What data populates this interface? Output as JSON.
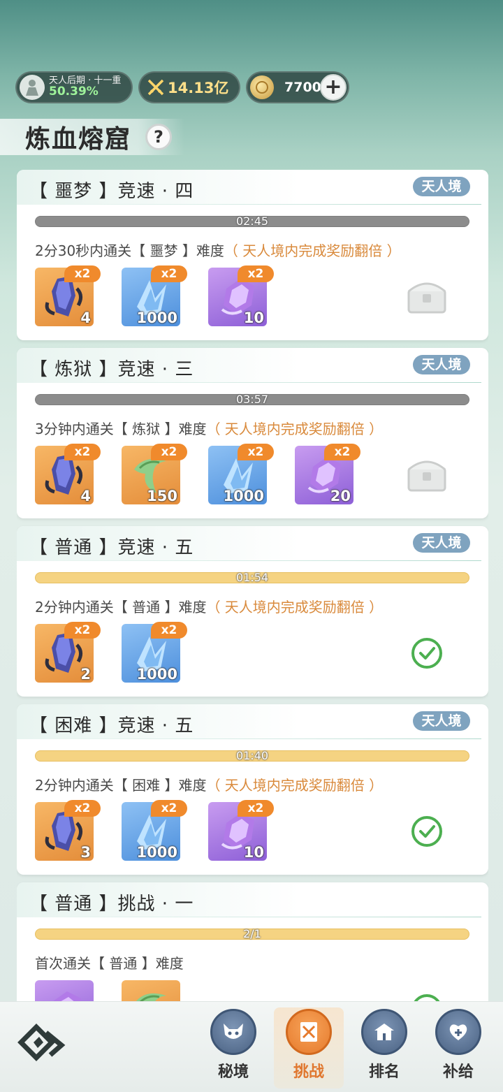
{
  "status": {
    "realm_name": "天人后期 · 十一重",
    "realm_progress": "50.39%",
    "power": "14.13亿",
    "coins": "7700"
  },
  "title": "炼血熔窟",
  "cards": [
    {
      "title": "【 噩梦 】竞速 · 四",
      "badge": "天人境",
      "timer": "02:45",
      "desc_main": "2分30秒内通关【 噩梦 】难度",
      "desc_note": "（ 天人境内完成奖励翻倍 ）",
      "rewards": [
        {
          "icon": "dark-crystal-icon",
          "multiplier": "x2",
          "qty": "4"
        },
        {
          "icon": "blue-crystal-icon",
          "multiplier": "x2",
          "qty": "1000"
        },
        {
          "icon": "purple-gem-icon",
          "multiplier": "x2",
          "qty": "10"
        }
      ],
      "status_icon": "treasure-chest-icon"
    },
    {
      "title": "【 炼狱 】竞速 · 三",
      "badge": "天人境",
      "timer": "03:57",
      "desc_main": "3分钟内通关【 炼狱 】难度",
      "desc_note": "（ 天人境内完成奖励翻倍 ）",
      "rewards": [
        {
          "icon": "dark-crystal-icon",
          "multiplier": "x2",
          "qty": "4"
        },
        {
          "icon": "green-fang-icon",
          "multiplier": "x2",
          "qty": "150"
        },
        {
          "icon": "blue-crystal-icon",
          "multiplier": "x2",
          "qty": "1000"
        },
        {
          "icon": "purple-gem-icon",
          "multiplier": "x2",
          "qty": "20"
        }
      ],
      "status_icon": "treasure-chest-icon"
    },
    {
      "title": "【 普通 】竞速 · 五",
      "badge": "天人境",
      "timer": "01:54",
      "desc_main": "2分钟内通关【 普通 】难度",
      "desc_note": "（ 天人境内完成奖励翻倍 ）",
      "rewards": [
        {
          "icon": "dark-crystal-icon",
          "multiplier": "x2",
          "qty": "2"
        },
        {
          "icon": "blue-crystal-icon",
          "multiplier": "x2",
          "qty": "1000"
        }
      ],
      "status_icon": "check-icon"
    },
    {
      "title": "【 困难 】竞速 · 五",
      "badge": "天人境",
      "timer": "01:40",
      "desc_main": "2分钟内通关【 困难 】难度",
      "desc_note": "（ 天人境内完成奖励翻倍 ）",
      "rewards": [
        {
          "icon": "dark-crystal-icon",
          "multiplier": "x2",
          "qty": "3"
        },
        {
          "icon": "blue-crystal-icon",
          "multiplier": "x2",
          "qty": "1000"
        },
        {
          "icon": "purple-gem-icon",
          "multiplier": "x2",
          "qty": "10"
        }
      ],
      "status_icon": "check-icon"
    },
    {
      "title": "【 普通 】挑战 · 一",
      "badge": "",
      "timer": "2/1",
      "desc_main": "首次通关【 普通 】难度",
      "desc_note": "",
      "rewards": [
        {
          "icon": "purple-gem-icon",
          "multiplier": "",
          "qty": ""
        },
        {
          "icon": "green-fang-icon",
          "multiplier": "",
          "qty": ""
        }
      ],
      "status_icon": "check-icon"
    }
  ],
  "nav": [
    {
      "label": "秘境",
      "icon": "demon-mask-icon"
    },
    {
      "label": "挑战",
      "icon": "crossed-swords-icon",
      "active": true
    },
    {
      "label": "排名",
      "icon": "temple-icon"
    },
    {
      "label": "补给",
      "icon": "heart-plus-icon"
    }
  ],
  "colors": {
    "accent": "#f08a2c",
    "timer_active": "#f5d382",
    "timer_inactive": "#8c8c8c",
    "badge": "#7fa3bf",
    "note": "#d98a3c",
    "check": "#4caf50"
  }
}
